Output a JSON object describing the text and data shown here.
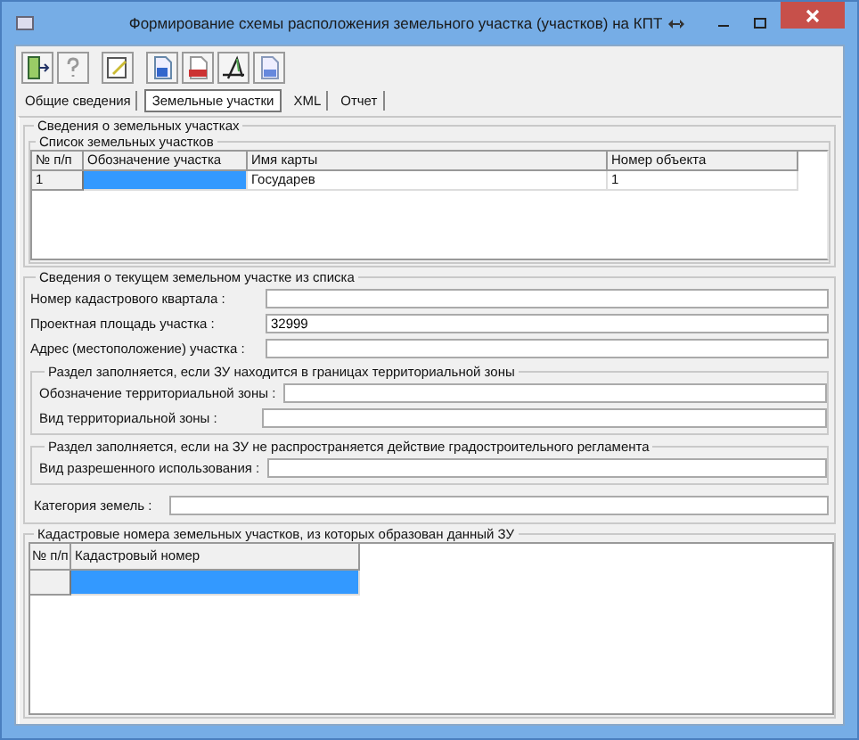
{
  "window": {
    "title": "Формирование схемы расположения земельного участка (участков) на КПТ"
  },
  "tabs": [
    {
      "label": "Общие сведения",
      "selected": false
    },
    {
      "label": "Земельные участки",
      "selected": true
    },
    {
      "label": "XML",
      "selected": false
    },
    {
      "label": "Отчет",
      "selected": false
    }
  ],
  "plots_group": {
    "title": "Сведения о земельных участках",
    "list_title": "Список земельных участков",
    "table": {
      "columns": [
        "№ п/п",
        "Обозначение участка",
        "Имя карты",
        "Номер объекта"
      ],
      "rows": [
        {
          "cells": [
            {
              "text": "1",
              "selected": false
            },
            {
              "selected": true
            },
            {
              "text": "Государев",
              "selected": false
            },
            {
              "text": "1",
              "selected": false
            }
          ]
        }
      ]
    }
  },
  "current_plot": {
    "title": "Сведения о текущем земельном участке из списка",
    "fields": [
      {
        "label": "Номер кадастрового квартала :"
      },
      {
        "label": "Проектная площадь участка :",
        "value": "32999"
      },
      {
        "label": "Адрес (местоположение) участка :"
      }
    ],
    "subsections": [
      {
        "title": "Раздел заполняется, если ЗУ находится в границах территориальной зоны",
        "fields": [
          {
            "label": "Обозначение территориальной зоны :"
          },
          {
            "label": "Вид территориальной зоны :"
          }
        ]
      },
      {
        "title": "Раздел заполняется, если на ЗУ не распространяется действие градостроительного регламента",
        "fields": [
          {
            "label": "Вид разрешенного использования :"
          }
        ]
      }
    ],
    "category": {
      "label": "Категория земель :"
    }
  },
  "source_plots": {
    "title": "Кадастровые номера земельных участков, из которых образован данный ЗУ",
    "table": {
      "columns": [
        "№ п/п",
        "Кадастровый номер"
      ],
      "rows": [
        {
          "cells": [
            {
              "selected": false
            },
            {
              "selected": true
            }
          ]
        }
      ]
    }
  }
}
